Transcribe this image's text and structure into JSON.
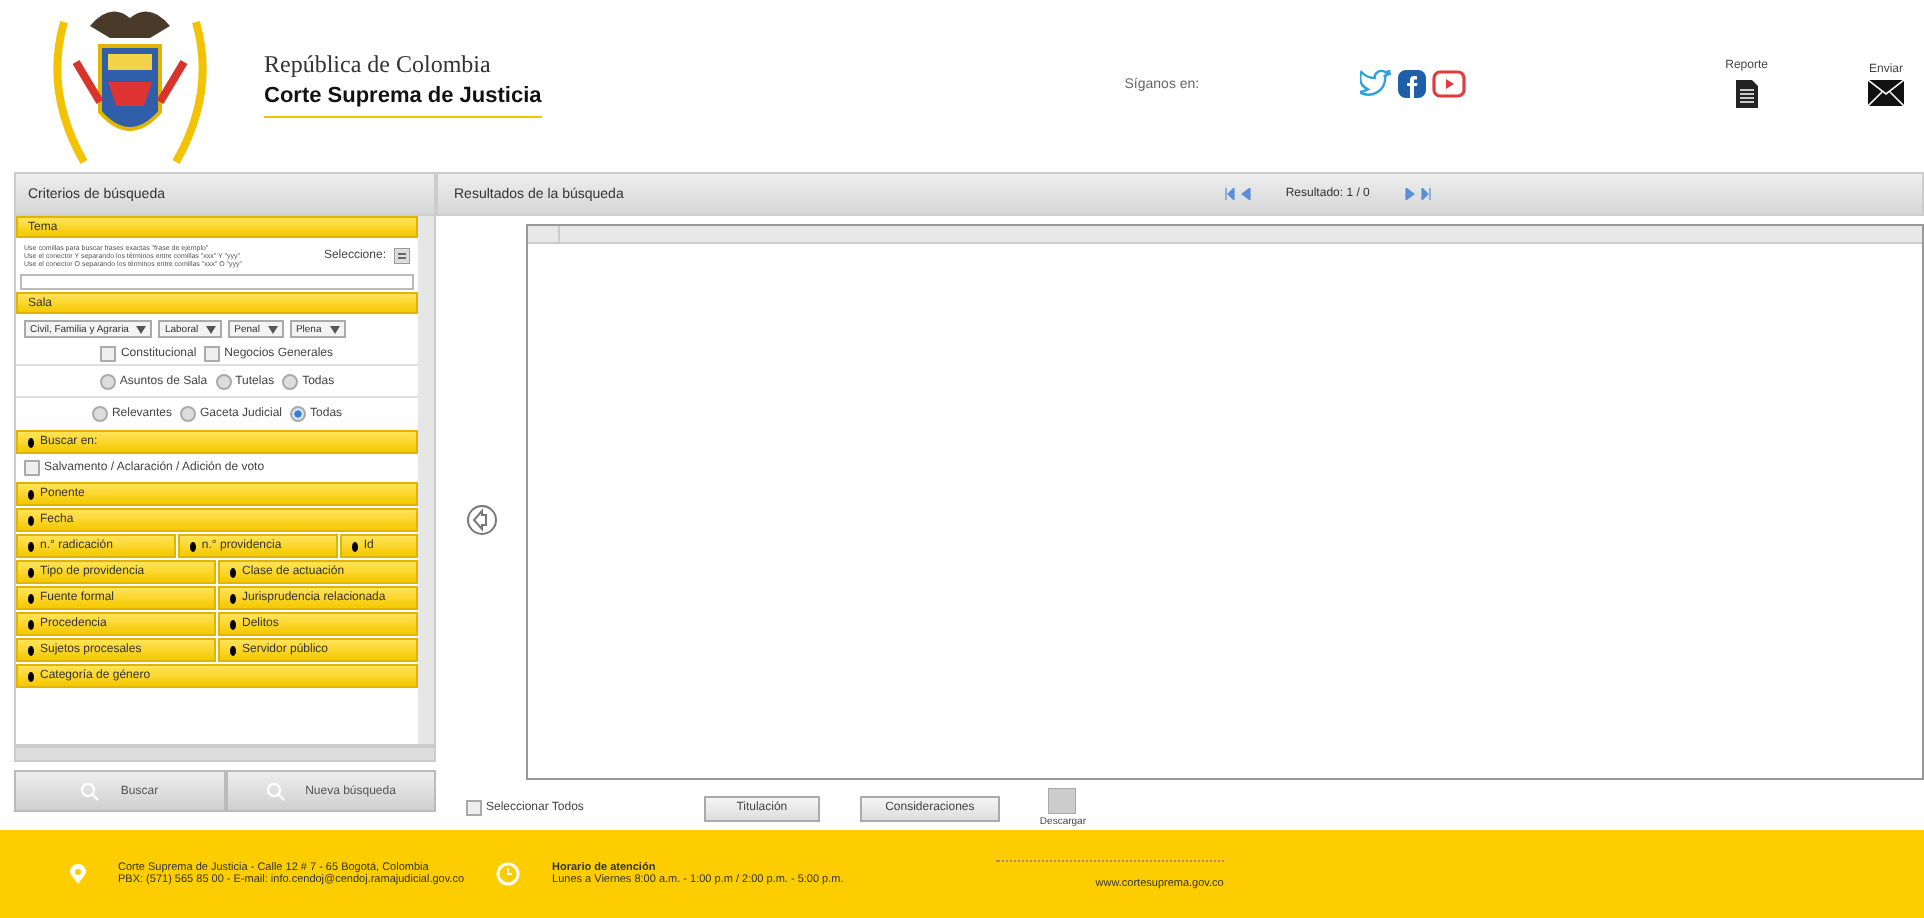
{
  "header": {
    "republic": "República de Colombia",
    "court": "Corte Suprema de Justicia",
    "follow": "Síganos en:",
    "report": "Reporte",
    "send": "Enviar"
  },
  "criteria": {
    "title": "Criterios de búsqueda",
    "tema": {
      "label": "Tema",
      "help": [
        "Use comillas para buscar frases exactas \"frase de ejemplo\"",
        "Use el conector Y separando los términos entre comillas \"xxx\" Y \"yyy\"",
        "Use el conector O separando los términos entre comillas \"xxx\" O \"yyy\""
      ],
      "select": "Seleccione:"
    },
    "sala": {
      "label": "Sala",
      "dropdowns": [
        "Civil, Familia y Agraria",
        "Laboral",
        "Penal",
        "Plena"
      ],
      "checks": [
        {
          "label": "Constitucional",
          "checked": false
        },
        {
          "label": "Negocios Generales",
          "checked": false
        }
      ],
      "radios_1": [
        {
          "label": "Asuntos de Sala",
          "selected": false
        },
        {
          "label": "Tutelas",
          "selected": false
        },
        {
          "label": "Todas",
          "selected": false
        }
      ],
      "radios_2": [
        {
          "label": "Relevantes",
          "selected": false
        },
        {
          "label": "Gaceta Judicial",
          "selected": false
        },
        {
          "label": "Todas",
          "selected": true
        }
      ]
    },
    "buscar_en": {
      "label": "Buscar en:",
      "option": {
        "label": "Salvamento / Aclaración / Adición de voto",
        "checked": false
      }
    },
    "filter_rows": [
      [
        "Ponente"
      ],
      [
        "Fecha"
      ],
      [
        "n.° radicación",
        "n.° providencia",
        "Id"
      ],
      [
        "Tipo de providencia",
        "Clase de actuación"
      ],
      [
        "Fuente formal",
        "Jurisprudencia relacionada"
      ],
      [
        "Procedencia",
        "Delitos"
      ],
      [
        "Sujetos procesales",
        "Servidor público"
      ],
      [
        "Categoría de género"
      ]
    ],
    "buttons": [
      "Buscar",
      "Nueva búsqueda"
    ]
  },
  "results": {
    "title": "Resultados de la búsqueda",
    "pager": "Resultado: 1 / 0",
    "select_all": {
      "label": "Seleccionar Todos",
      "checked": false
    },
    "buttons": [
      "Titulación",
      "Consideraciones"
    ],
    "download": "Descargar"
  },
  "footer": {
    "address": [
      "Corte Suprema de Justicia - Calle 12 # 7 - 65 Bogotá, Colombia",
      "PBX: (571) 565 85 00 - E-mail: info.cendoj@cendoj.ramajudicial.gov.co"
    ],
    "hours_title": "Horario de atención",
    "hours": "Lunes a Viernes 8:00 a.m. - 1:00 p.m / 2:00 p.m. - 5:00 p.m.",
    "website": "www.cortesuprema.gov.co"
  }
}
